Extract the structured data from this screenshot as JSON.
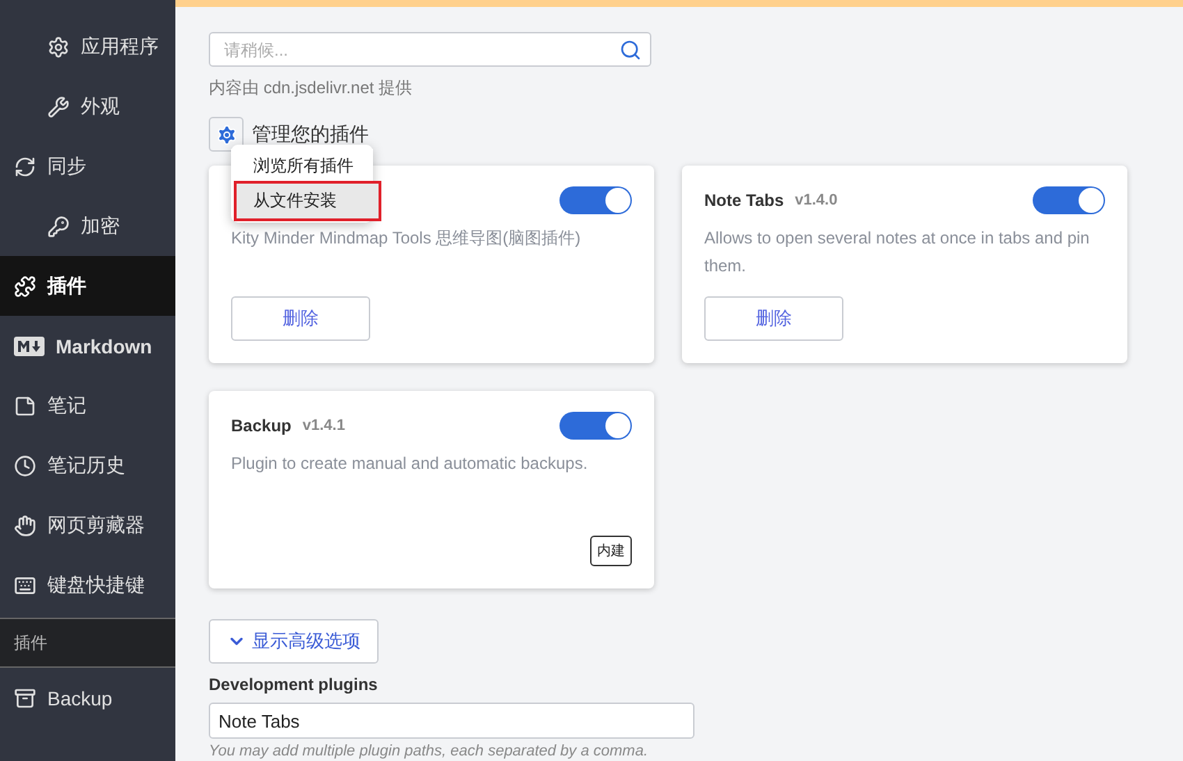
{
  "sidebar": {
    "items": [
      {
        "label": "应用程序",
        "sub": true,
        "selected": false,
        "kind": "item"
      },
      {
        "label": "外观",
        "sub": true,
        "selected": false,
        "kind": "item"
      },
      {
        "label": "同步",
        "sub": false,
        "selected": false,
        "kind": "item"
      },
      {
        "label": "加密",
        "sub": true,
        "selected": false,
        "kind": "item"
      },
      {
        "label": "插件",
        "sub": false,
        "selected": true,
        "kind": "item"
      },
      {
        "label": "Markdown",
        "sub": false,
        "selected": false,
        "kind": "item"
      },
      {
        "label": "笔记",
        "sub": false,
        "selected": false,
        "kind": "item"
      },
      {
        "label": "笔记历史",
        "sub": false,
        "selected": false,
        "kind": "item"
      },
      {
        "label": "网页剪藏器",
        "sub": false,
        "selected": false,
        "kind": "item"
      },
      {
        "label": "键盘快捷键",
        "sub": false,
        "selected": false,
        "kind": "item"
      },
      {
        "label": "插件",
        "kind": "header"
      },
      {
        "label": "Backup",
        "sub": false,
        "selected": false,
        "kind": "item"
      }
    ]
  },
  "search": {
    "placeholder": "请稍候..."
  },
  "source_note": "内容由 cdn.jsdelivr.net 提供",
  "manage_heading": "管理您的插件",
  "menu": {
    "items": [
      {
        "label": "浏览所有插件",
        "highlighted": false
      },
      {
        "label": "从文件安装",
        "highlighted": true
      }
    ]
  },
  "plugins": [
    {
      "on": true,
      "description": "Kity Minder Mindmap Tools 思维导图(脑图插件)",
      "action": "删除"
    },
    {
      "name": "Note Tabs",
      "version": "v1.4.0",
      "on": true,
      "description": "Allows to open several notes at once in tabs and pin them.",
      "action": "删除"
    },
    {
      "name": "Backup",
      "version": "v1.4.1",
      "on": true,
      "description": "Plugin to create manual and automatic backups.",
      "badge": "内建"
    }
  ],
  "advanced_button": "显示高级选项",
  "dev_plugins": {
    "label": "Development plugins",
    "value": "Note Tabs",
    "hint": "You may add multiple plugin paths, each separated by a comma."
  }
}
